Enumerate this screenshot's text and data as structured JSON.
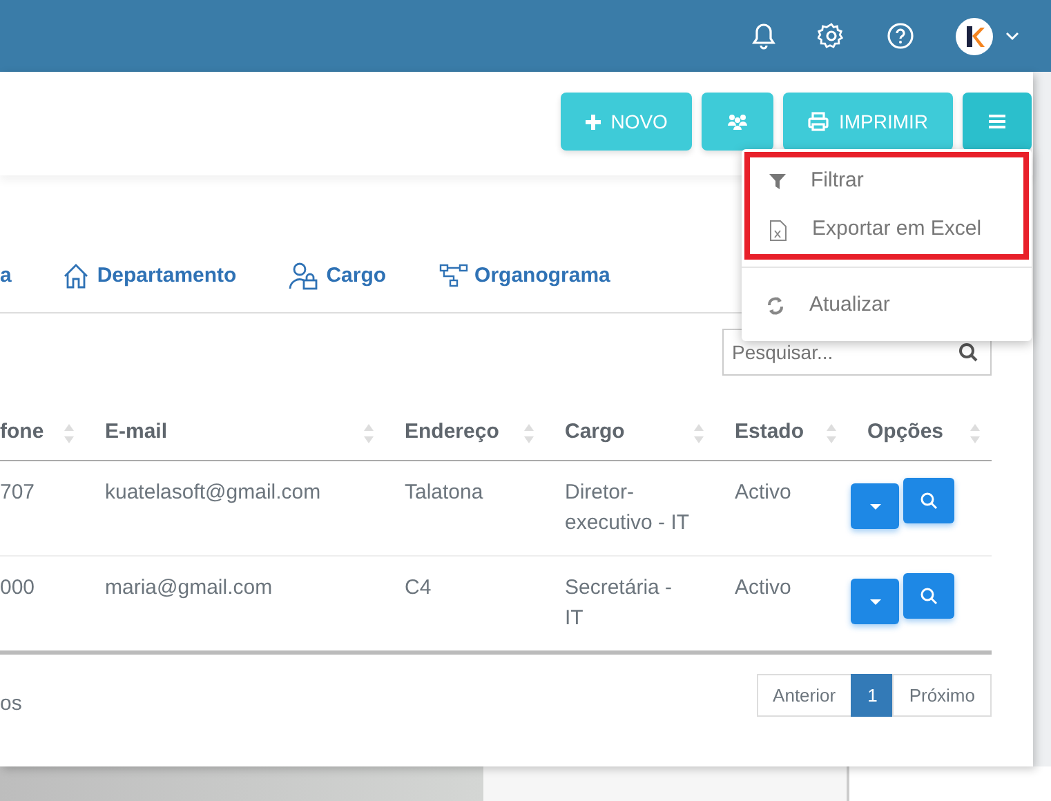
{
  "toolbar": {
    "buttons": [
      {
        "kind": "new",
        "label": "NOVO"
      },
      {
        "kind": "group"
      },
      {
        "kind": "print",
        "label": "IMPRIMIR"
      },
      {
        "kind": "menu",
        "expanded": true
      }
    ]
  },
  "menu": {
    "items": [
      {
        "kind": "filter",
        "label": "Filtrar",
        "highlighted": true
      },
      {
        "kind": "excel",
        "label": "Exportar em Excel",
        "highlighted": true
      },
      {
        "kind": "divider"
      },
      {
        "kind": "refresh",
        "label": "Atualizar",
        "highlighted": false
      }
    ]
  },
  "tabs": [
    {
      "kind": "none",
      "label": "a"
    },
    {
      "kind": "house",
      "label": "Departamento"
    },
    {
      "kind": "user",
      "label": "Cargo"
    },
    {
      "kind": "org",
      "label": "Organograma"
    }
  ],
  "search": {
    "placeholder": "Pesquisar..."
  },
  "table": {
    "columns": [
      "fone",
      "E-mail",
      "Endereço",
      "Cargo",
      "Estado",
      "Opções"
    ],
    "rows": [
      {
        "cells": [
          "707",
          "kuatelasoft@gmail.com",
          "Talatona",
          "Diretor-executivo - IT",
          "Activo"
        ]
      },
      {
        "cells": [
          "000",
          "maria@gmail.com",
          "C4",
          "Secretária - IT",
          "Activo"
        ]
      }
    ]
  },
  "footer": {
    "info": "os"
  },
  "pagination": [
    {
      "label": "Anterior",
      "selected": false
    },
    {
      "label": "1",
      "selected": true
    },
    {
      "label": "Próximo",
      "selected": false
    }
  ]
}
